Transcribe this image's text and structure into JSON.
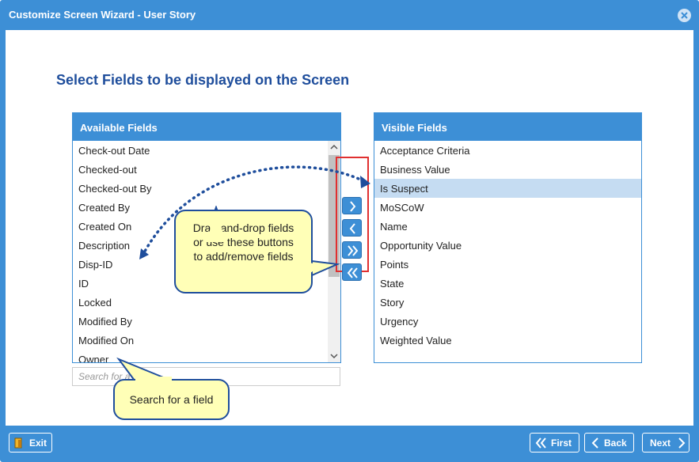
{
  "window": {
    "title": "Customize Screen Wizard - User Story"
  },
  "heading": "Select Fields to be displayed on the Screen",
  "available": {
    "header": "Available Fields",
    "items": [
      "Check-out Date",
      "Checked-out",
      "Checked-out By",
      "Created By",
      "Created On",
      "Description",
      "Disp-ID",
      "ID",
      "Locked",
      "Modified By",
      "Modified On",
      "Owner"
    ]
  },
  "visible": {
    "header": "Visible Fields",
    "items": [
      "Acceptance Criteria",
      "Business Value",
      "Is Suspect",
      "MoSCoW",
      "Name",
      "Opportunity Value",
      "Points",
      "State",
      "Story",
      "Urgency",
      "Weighted Value"
    ],
    "selected": "Is Suspect"
  },
  "search": {
    "placeholder": "Search for a field"
  },
  "callouts": {
    "drag_line1": "Drag-and-drop fields",
    "drag_line2": "or use these buttons",
    "drag_line3": "to add/remove fields",
    "search": "Search for a field"
  },
  "footer": {
    "exit": "Exit",
    "first": "First",
    "back": "Back",
    "next": "Next"
  },
  "colors": {
    "accent": "#3d8fd6",
    "heading": "#1f4e9c",
    "callout": "#ffffb7",
    "highlight": "#e03030"
  }
}
